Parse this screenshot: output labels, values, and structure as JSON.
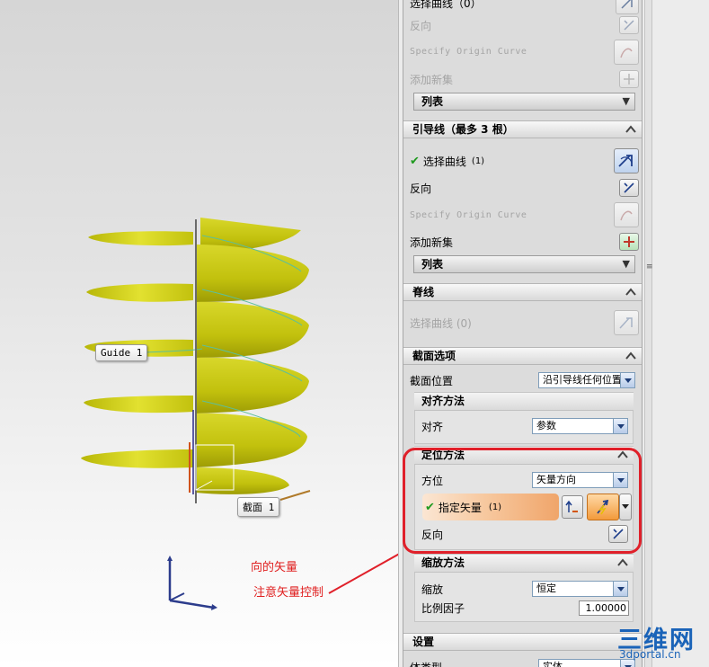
{
  "viewport": {
    "tag_guide": "Guide 1",
    "tag_section": "截面 1",
    "note_line1": "向的矢量",
    "note_line2": "注意矢量控制"
  },
  "dialog": {
    "top_group": {
      "select_curve_partial": "选择曲线（0）",
      "reverse_label": "反向",
      "origin_curve_label": "Specify Origin Curve",
      "add_new_set_label": "添加新集",
      "list_label": "列表"
    },
    "guide_group": {
      "title": "引导线（最多 3 根）",
      "select_curve_label": "选择曲线",
      "select_curve_count": "(1)",
      "reverse_label": "反向",
      "origin_curve_label": "Specify Origin Curve",
      "add_new_set_label": "添加新集",
      "list_label": "列表"
    },
    "spine_group": {
      "title": "脊线",
      "select_curve_label": "选择曲线 (0)"
    },
    "section_options": {
      "title": "截面选项",
      "section_position_label": "截面位置",
      "section_position_value": "沿引导线任何位置",
      "alignment": {
        "title": "对齐方法",
        "align_label": "对齐",
        "align_value": "参数"
      },
      "orientation": {
        "title": "定位方法",
        "orientation_label": "方位",
        "orientation_value": "矢量方向",
        "specify_vector_label": "指定矢量",
        "specify_vector_count": "(1)",
        "reverse_label": "反向"
      },
      "scaling": {
        "title": "缩放方法",
        "scale_label": "缩放",
        "scale_value": "恒定",
        "ratio_label": "比例因子",
        "ratio_value": "1.00000"
      }
    },
    "settings": {
      "title": "设置",
      "body_type_label": "体类型",
      "body_type_value": "实体"
    }
  },
  "watermark": {
    "brand": "三维网",
    "url": "3dportal.cn"
  },
  "colors": {
    "surface": "#c9c812",
    "annotation_red": "#e0202a",
    "check_green": "#1f9a1f",
    "highlight_orange": "#f0a56a"
  }
}
